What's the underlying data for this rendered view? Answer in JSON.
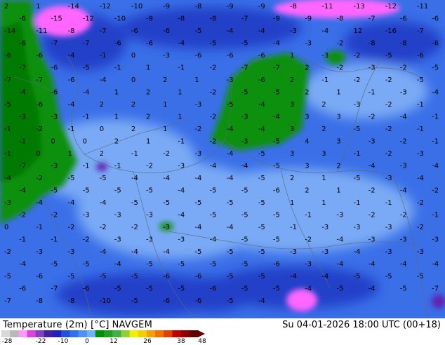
{
  "title": {
    "parameter": "Temperature (2m) [°C]",
    "model": "NAVGEM",
    "valid_time": "Su 04-01-2026 18:00 UTC (00+18)"
  },
  "colorbar": {
    "ticks": [
      "-28",
      "-22",
      "-10",
      "0",
      "12",
      "26",
      "38",
      "48"
    ],
    "colors": [
      "#d8d8d8",
      "#b8b8b8",
      "#ff99ff",
      "#e040e0",
      "#8040c0",
      "#4020a0",
      "#2020c0",
      "#2050e0",
      "#3070f0",
      "#5090f0",
      "#70b0f8",
      "#009000",
      "#20a020",
      "#40b040",
      "#90d030",
      "#f0f000",
      "#f0d000",
      "#f0a000",
      "#f07000",
      "#e04000",
      "#c00000",
      "#900000",
      "#600000"
    ]
  },
  "map_colors": {
    "cold_blue": "#3a6fe8",
    "mid_blue": "#5c8ff2",
    "light_blue": "#7aaaf5",
    "deep_blue": "#2040c8",
    "green": "#109010",
    "dark_green": "#067a06",
    "magenta": "#ff66ff",
    "pink": "#ffaaff",
    "purple": "#6020b0"
  },
  "values": [
    {
      "t": "2"
    },
    {
      "t": "1"
    },
    {
      "t": "-14"
    },
    {
      "t": "-12"
    },
    {
      "t": "-10"
    },
    {
      "t": "-9"
    },
    {
      "t": "-8"
    },
    {
      "t": "-9"
    },
    {
      "t": "-9"
    },
    {
      "t": "-8"
    },
    {
      "t": "-11"
    },
    {
      "t": "-13"
    },
    {
      "t": "-12"
    },
    {
      "t": "-11"
    },
    {
      "t": "-6"
    },
    {
      "t": "-15"
    },
    {
      "t": "-12"
    },
    {
      "t": "-10"
    },
    {
      "t": "-9"
    },
    {
      "t": "-8"
    },
    {
      "t": "-8"
    },
    {
      "t": "-7"
    },
    {
      "t": "-9"
    },
    {
      "t": "-9"
    },
    {
      "t": "-8"
    },
    {
      "t": "-7"
    },
    {
      "t": "-6"
    },
    {
      "t": "-6"
    },
    {
      "t": "-14"
    },
    {
      "t": "-11"
    },
    {
      "t": "-8"
    },
    {
      "t": "-7"
    },
    {
      "t": "-6"
    },
    {
      "t": "-6"
    },
    {
      "t": "-5"
    },
    {
      "t": "-4"
    },
    {
      "t": "-4"
    },
    {
      "t": "-3"
    },
    {
      "t": "-4"
    },
    {
      "t": "12"
    },
    {
      "t": "-16"
    },
    {
      "t": "-7"
    },
    {
      "t": "-6"
    },
    {
      "t": "-7"
    },
    {
      "t": "-7"
    },
    {
      "t": "-6"
    },
    {
      "t": "-6"
    },
    {
      "t": "-4"
    },
    {
      "t": "-5"
    },
    {
      "t": "-5"
    },
    {
      "t": "-4"
    },
    {
      "t": "-3"
    },
    {
      "t": "-2"
    },
    {
      "t": "-8"
    },
    {
      "t": "-8"
    },
    {
      "t": "-6"
    },
    {
      "t": "-6"
    },
    {
      "t": "-6"
    },
    {
      "t": "-4"
    },
    {
      "t": "-1"
    },
    {
      "t": "0"
    },
    {
      "t": "-3"
    },
    {
      "t": "-6"
    },
    {
      "t": "-6"
    },
    {
      "t": "-6"
    },
    {
      "t": "1"
    },
    {
      "t": "-3"
    },
    {
      "t": "-2"
    },
    {
      "t": "-5"
    },
    {
      "t": "-6"
    },
    {
      "t": "-7"
    },
    {
      "t": "-6"
    },
    {
      "t": "-5"
    },
    {
      "t": "-1"
    },
    {
      "t": "1"
    },
    {
      "t": "-1"
    },
    {
      "t": "-2"
    },
    {
      "t": "-7"
    },
    {
      "t": "-7"
    },
    {
      "t": "2"
    },
    {
      "t": "-2"
    },
    {
      "t": "-3"
    },
    {
      "t": "-2"
    },
    {
      "t": "-5"
    },
    {
      "t": "-7"
    },
    {
      "t": "-7"
    },
    {
      "t": "-6"
    },
    {
      "t": "-4"
    },
    {
      "t": "0"
    },
    {
      "t": "2"
    },
    {
      "t": "1"
    },
    {
      "t": "-3"
    },
    {
      "t": "-6"
    },
    {
      "t": "2"
    },
    {
      "t": "-1"
    },
    {
      "t": "-2"
    },
    {
      "t": "-2"
    },
    {
      "t": "-5"
    },
    {
      "t": "-4"
    },
    {
      "t": "-6"
    },
    {
      "t": "-4"
    },
    {
      "t": "1"
    },
    {
      "t": "2"
    },
    {
      "t": "1"
    },
    {
      "t": "-2"
    },
    {
      "t": "-5"
    },
    {
      "t": "-5"
    },
    {
      "t": "2"
    },
    {
      "t": "1"
    },
    {
      "t": "-1"
    },
    {
      "t": "-3"
    },
    {
      "t": "-4"
    },
    {
      "t": "-5"
    },
    {
      "t": "-6"
    },
    {
      "t": "-4"
    },
    {
      "t": "2"
    },
    {
      "t": "2"
    },
    {
      "t": "1"
    },
    {
      "t": "-3"
    },
    {
      "t": "-5"
    },
    {
      "t": "-4"
    },
    {
      "t": "3"
    },
    {
      "t": "2"
    },
    {
      "t": "-3"
    },
    {
      "t": "-2"
    },
    {
      "t": "-1"
    },
    {
      "t": "-3"
    },
    {
      "t": "-3"
    },
    {
      "t": "-1"
    },
    {
      "t": "1"
    },
    {
      "t": "2"
    },
    {
      "t": "1"
    },
    {
      "t": "-2"
    },
    {
      "t": "-3"
    },
    {
      "t": "-4"
    },
    {
      "t": "3"
    },
    {
      "t": "3"
    },
    {
      "t": "-2"
    },
    {
      "t": "-4"
    },
    {
      "t": "-1"
    },
    {
      "t": "-1"
    },
    {
      "t": "-2"
    },
    {
      "t": "-1"
    },
    {
      "t": "0"
    },
    {
      "t": "2"
    },
    {
      "t": "1"
    },
    {
      "t": "-2"
    },
    {
      "t": "-4"
    },
    {
      "t": "-4"
    },
    {
      "t": "3"
    },
    {
      "t": "2"
    },
    {
      "t": "-5"
    },
    {
      "t": "-2"
    },
    {
      "t": "-1"
    },
    {
      "t": "-1"
    },
    {
      "t": "0"
    },
    {
      "t": "0"
    },
    {
      "t": "2"
    },
    {
      "t": "1"
    },
    {
      "t": "-1"
    },
    {
      "t": "-2"
    },
    {
      "t": "-3"
    },
    {
      "t": "-5"
    },
    {
      "t": "4"
    },
    {
      "t": "3"
    },
    {
      "t": "-3"
    },
    {
      "t": "-2"
    },
    {
      "t": "-1"
    },
    {
      "t": "-1"
    },
    {
      "t": "0"
    },
    {
      "t": "1"
    },
    {
      "t": "2"
    },
    {
      "t": "-1"
    },
    {
      "t": "-2"
    },
    {
      "t": "-3"
    },
    {
      "t": "-4"
    },
    {
      "t": "-5"
    },
    {
      "t": "3"
    },
    {
      "t": "3"
    },
    {
      "t": "-1"
    },
    {
      "t": "-2"
    },
    {
      "t": "-3"
    },
    {
      "t": "-7"
    },
    {
      "t": "-3"
    },
    {
      "t": "-1"
    },
    {
      "t": "-1"
    },
    {
      "t": "-2"
    },
    {
      "t": "-3"
    },
    {
      "t": "-4"
    },
    {
      "t": "-4"
    },
    {
      "t": "-5"
    },
    {
      "t": "3"
    },
    {
      "t": "2"
    },
    {
      "t": "-4"
    },
    {
      "t": "-3"
    },
    {
      "t": "-4"
    },
    {
      "t": "-4"
    },
    {
      "t": "-2"
    },
    {
      "t": "-5"
    },
    {
      "t": "-5"
    },
    {
      "t": "-4"
    },
    {
      "t": "-4"
    },
    {
      "t": "-4"
    },
    {
      "t": "-4"
    },
    {
      "t": "-5"
    },
    {
      "t": "2"
    },
    {
      "t": "1"
    },
    {
      "t": "-5"
    },
    {
      "t": "-3"
    },
    {
      "t": "-4"
    },
    {
      "t": "-4"
    },
    {
      "t": "-5"
    },
    {
      "t": "-5"
    },
    {
      "t": "-5"
    },
    {
      "t": "-5"
    },
    {
      "t": "-4"
    },
    {
      "t": "-5"
    },
    {
      "t": "-5"
    },
    {
      "t": "-6"
    },
    {
      "t": "2"
    },
    {
      "t": "1"
    },
    {
      "t": "-2"
    },
    {
      "t": "-4"
    },
    {
      "t": "-2"
    },
    {
      "t": "-3"
    },
    {
      "t": "-4"
    },
    {
      "t": "-4"
    },
    {
      "t": "-4"
    },
    {
      "t": "-5"
    },
    {
      "t": "-5"
    },
    {
      "t": "-5"
    },
    {
      "t": "-5"
    },
    {
      "t": "-5"
    },
    {
      "t": "1"
    },
    {
      "t": "1"
    },
    {
      "t": "-1"
    },
    {
      "t": "-1"
    },
    {
      "t": "-2"
    },
    {
      "t": "-2"
    },
    {
      "t": "-2"
    },
    {
      "t": "-3"
    },
    {
      "t": "-3"
    },
    {
      "t": "-3"
    },
    {
      "t": "-4"
    },
    {
      "t": "-5"
    },
    {
      "t": "-5"
    },
    {
      "t": "-5"
    },
    {
      "t": "-1"
    },
    {
      "t": "-3"
    },
    {
      "t": "-2"
    },
    {
      "t": "-2"
    },
    {
      "t": "-1"
    },
    {
      "t": "0"
    },
    {
      "t": "-1"
    },
    {
      "t": "-2"
    },
    {
      "t": "-2"
    },
    {
      "t": "-2"
    },
    {
      "t": "-3"
    },
    {
      "t": "-4"
    },
    {
      "t": "-4"
    },
    {
      "t": "-5"
    },
    {
      "t": "-1"
    },
    {
      "t": "-3"
    },
    {
      "t": "-3"
    },
    {
      "t": "-3"
    },
    {
      "t": "-2"
    },
    {
      "t": "-1"
    },
    {
      "t": "-1"
    },
    {
      "t": "-2"
    },
    {
      "t": "-3"
    },
    {
      "t": "-3"
    },
    {
      "t": "-3"
    },
    {
      "t": "-4"
    },
    {
      "t": "-5"
    },
    {
      "t": "-5"
    },
    {
      "t": "-2"
    },
    {
      "t": "-4"
    },
    {
      "t": "-3"
    },
    {
      "t": "-3"
    },
    {
      "t": "-3"
    },
    {
      "t": "-2"
    },
    {
      "t": "-3"
    },
    {
      "t": "-3"
    },
    {
      "t": "-4"
    },
    {
      "t": "-4"
    },
    {
      "t": "-4"
    },
    {
      "t": "-5"
    },
    {
      "t": "-5"
    },
    {
      "t": "-5"
    },
    {
      "t": "-3"
    },
    {
      "t": "-3"
    },
    {
      "t": "-4"
    },
    {
      "t": "-3"
    },
    {
      "t": "-3"
    },
    {
      "t": "-4"
    },
    {
      "t": "-5"
    },
    {
      "t": "-5"
    },
    {
      "t": "-4"
    },
    {
      "t": "-5"
    },
    {
      "t": "-5"
    },
    {
      "t": "-5"
    },
    {
      "t": "-5"
    },
    {
      "t": "-6"
    },
    {
      "t": "-3"
    },
    {
      "t": "-4"
    },
    {
      "t": "-4"
    },
    {
      "t": "-4"
    },
    {
      "t": "-4"
    },
    {
      "t": "-5"
    },
    {
      "t": "-6"
    },
    {
      "t": "-5"
    },
    {
      "t": "-5"
    },
    {
      "t": "-5"
    },
    {
      "t": "-6"
    },
    {
      "t": "-6"
    },
    {
      "t": "-5"
    },
    {
      "t": "-5"
    },
    {
      "t": "-4"
    },
    {
      "t": "-4"
    },
    {
      "t": "-5"
    },
    {
      "t": "-5"
    },
    {
      "t": "-5"
    },
    {
      "t": "-6"
    },
    {
      "t": "-7"
    },
    {
      "t": "-6"
    },
    {
      "t": "-5"
    },
    {
      "t": "-5"
    },
    {
      "t": "-5"
    },
    {
      "t": "-6"
    },
    {
      "t": "-5"
    },
    {
      "t": "-5"
    },
    {
      "t": "-4"
    },
    {
      "t": "-5"
    },
    {
      "t": "-4"
    },
    {
      "t": "-5"
    },
    {
      "t": "-7"
    },
    {
      "t": "-7"
    },
    {
      "t": "-8"
    },
    {
      "t": "-8"
    },
    {
      "t": "-10"
    },
    {
      "t": "-5"
    },
    {
      "t": "-6"
    },
    {
      "t": "-6"
    },
    {
      "t": "-5"
    },
    {
      "t": "-4"
    }
  ]
}
